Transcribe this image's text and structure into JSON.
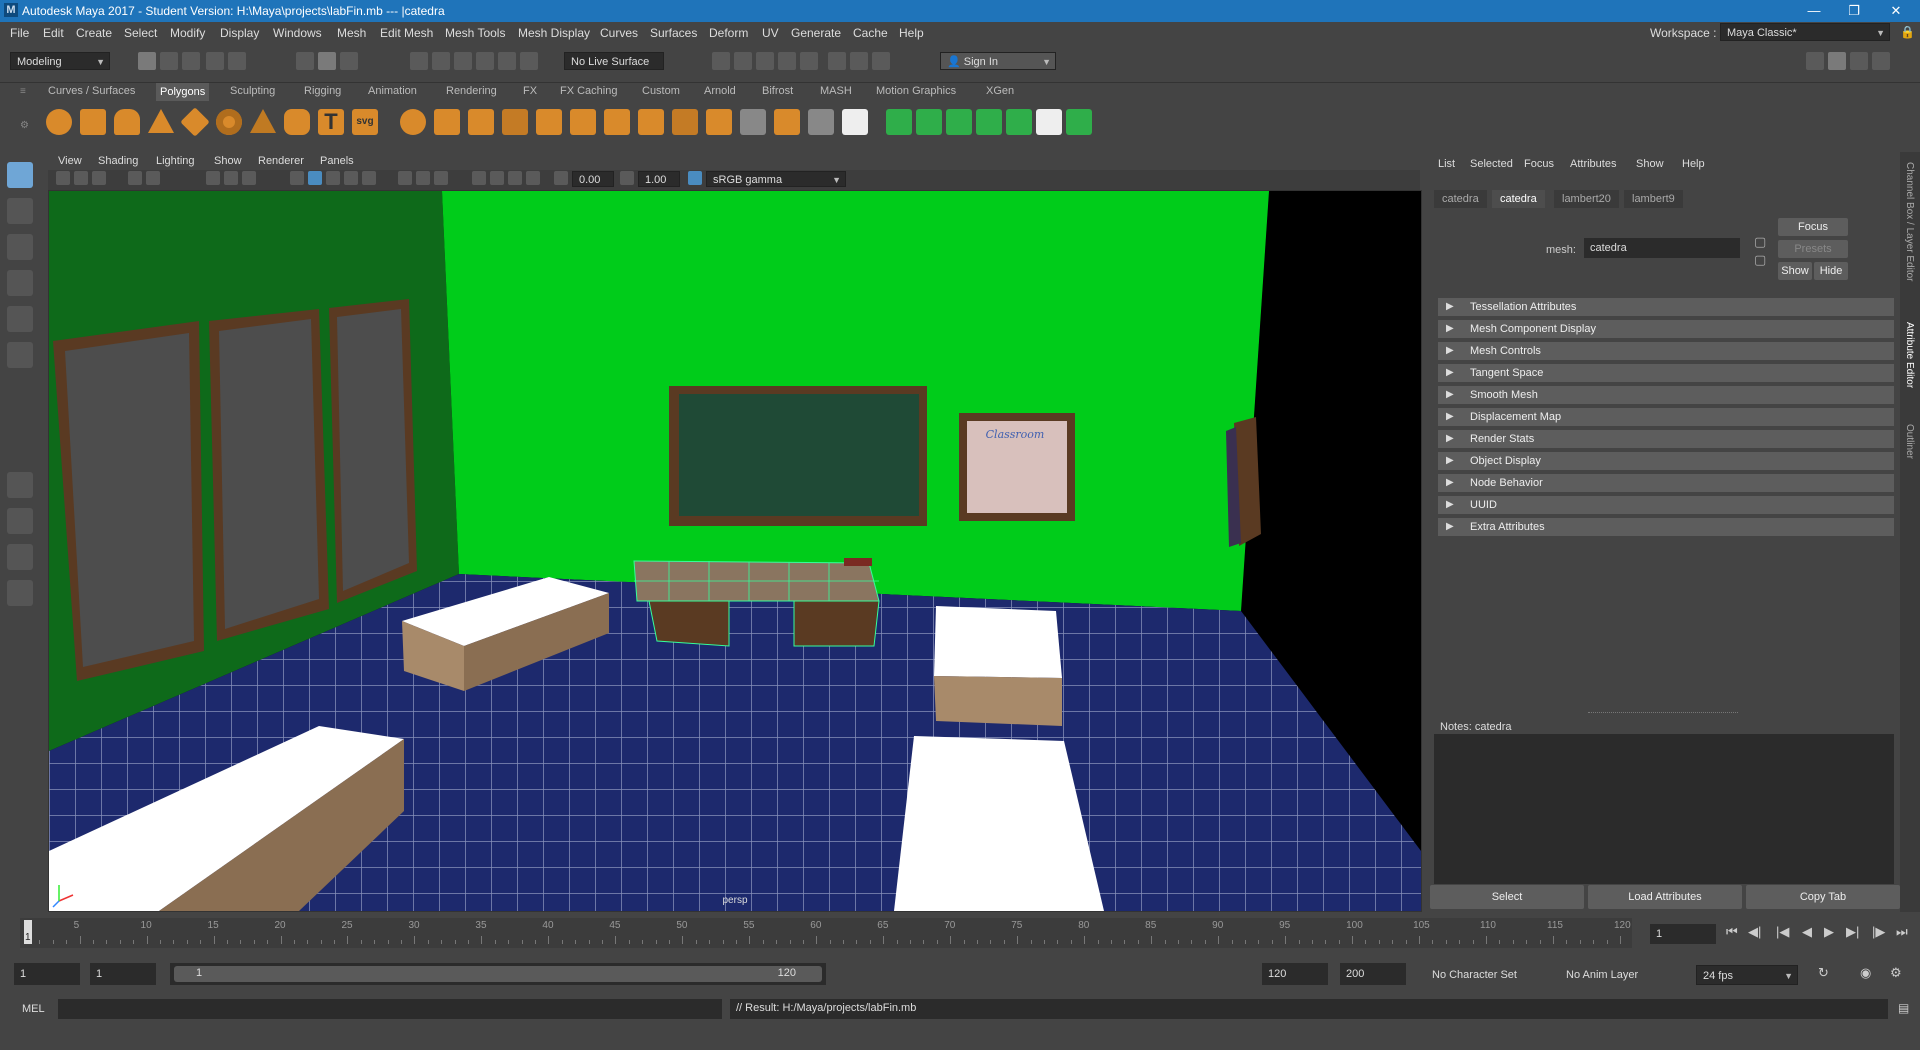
{
  "window": {
    "title": "Autodesk Maya 2017 - Student Version: H:\\Maya\\projects\\labFin.mb  ---  |catedra",
    "logo": "M"
  },
  "menubar": [
    "File",
    "Edit",
    "Create",
    "Select",
    "Modify",
    "Display",
    "Windows",
    "Mesh",
    "Edit Mesh",
    "Mesh Tools",
    "Mesh Display",
    "Curves",
    "Surfaces",
    "Deform",
    "UV",
    "Generate",
    "Cache",
    "Help"
  ],
  "workspace": {
    "label": "Workspace :",
    "value": "Maya Classic*"
  },
  "statusline": {
    "mode": "Modeling",
    "live_surface": "No Live Surface",
    "sign_in": "Sign In"
  },
  "shelf_tabs": [
    "Curves / Surfaces",
    "Polygons",
    "Sculpting",
    "Rigging",
    "Animation",
    "Rendering",
    "FX",
    "FX Caching",
    "Custom",
    "Arnold",
    "Bifrost",
    "MASH",
    "Motion Graphics",
    "XGen"
  ],
  "shelf_active": "Polygons",
  "viewport": {
    "menu": [
      "View",
      "Shading",
      "Lighting",
      "Show",
      "Renderer",
      "Panels"
    ],
    "exposure": "0.00",
    "gamma": "1.00",
    "colorspace": "sRGB gamma",
    "camera_label": "persp",
    "poster_text": "Classroom"
  },
  "attribute_editor": {
    "menu": [
      "List",
      "Selected",
      "Focus",
      "Attributes",
      "Show",
      "Help"
    ],
    "tabs": [
      "catedra",
      "catedra",
      "lambert20",
      "lambert9"
    ],
    "active_tab_index": 1,
    "mesh_label": "mesh:",
    "mesh_value": "catedra",
    "buttons": {
      "focus": "Focus",
      "presets": "Presets",
      "show": "Show",
      "hide": "Hide"
    },
    "sections": [
      "Tessellation Attributes",
      "Mesh Component Display",
      "Mesh Controls",
      "Tangent Space",
      "Smooth Mesh",
      "Displacement Map",
      "Render Stats",
      "Object Display",
      "Node Behavior",
      "UUID",
      "Extra Attributes"
    ],
    "notes_label": "Notes:  catedra",
    "bottom_buttons": [
      "Select",
      "Load Attributes",
      "Copy Tab"
    ]
  },
  "side_tabs": [
    "Channel Box / Layer Editor",
    "Attribute Editor",
    "Outliner"
  ],
  "timeline": {
    "ticks": [
      1,
      5,
      10,
      15,
      20,
      25,
      30,
      35,
      40,
      45,
      50,
      55,
      60,
      65,
      70,
      75,
      80,
      85,
      90,
      95,
      100,
      105,
      110,
      115,
      120
    ],
    "current_frame": "1",
    "current_frame_field": "1"
  },
  "range": {
    "start": "1",
    "playback_start": "1",
    "slider_start": "1",
    "slider_end": "120",
    "playback_end": "120",
    "end": "200",
    "character_set": "No Character Set",
    "anim_layer": "No Anim Layer",
    "fps": "24 fps"
  },
  "command": {
    "lang": "MEL",
    "result": "// Result: H:/Maya/projects/labFin.mb"
  },
  "colors": {
    "titlebar": "#1f74ba",
    "green_wall": "#00cc1a",
    "floor": "#1e2a6e",
    "shelf_orange": "#d98a2b",
    "shelf_green": "#2fae4a"
  }
}
